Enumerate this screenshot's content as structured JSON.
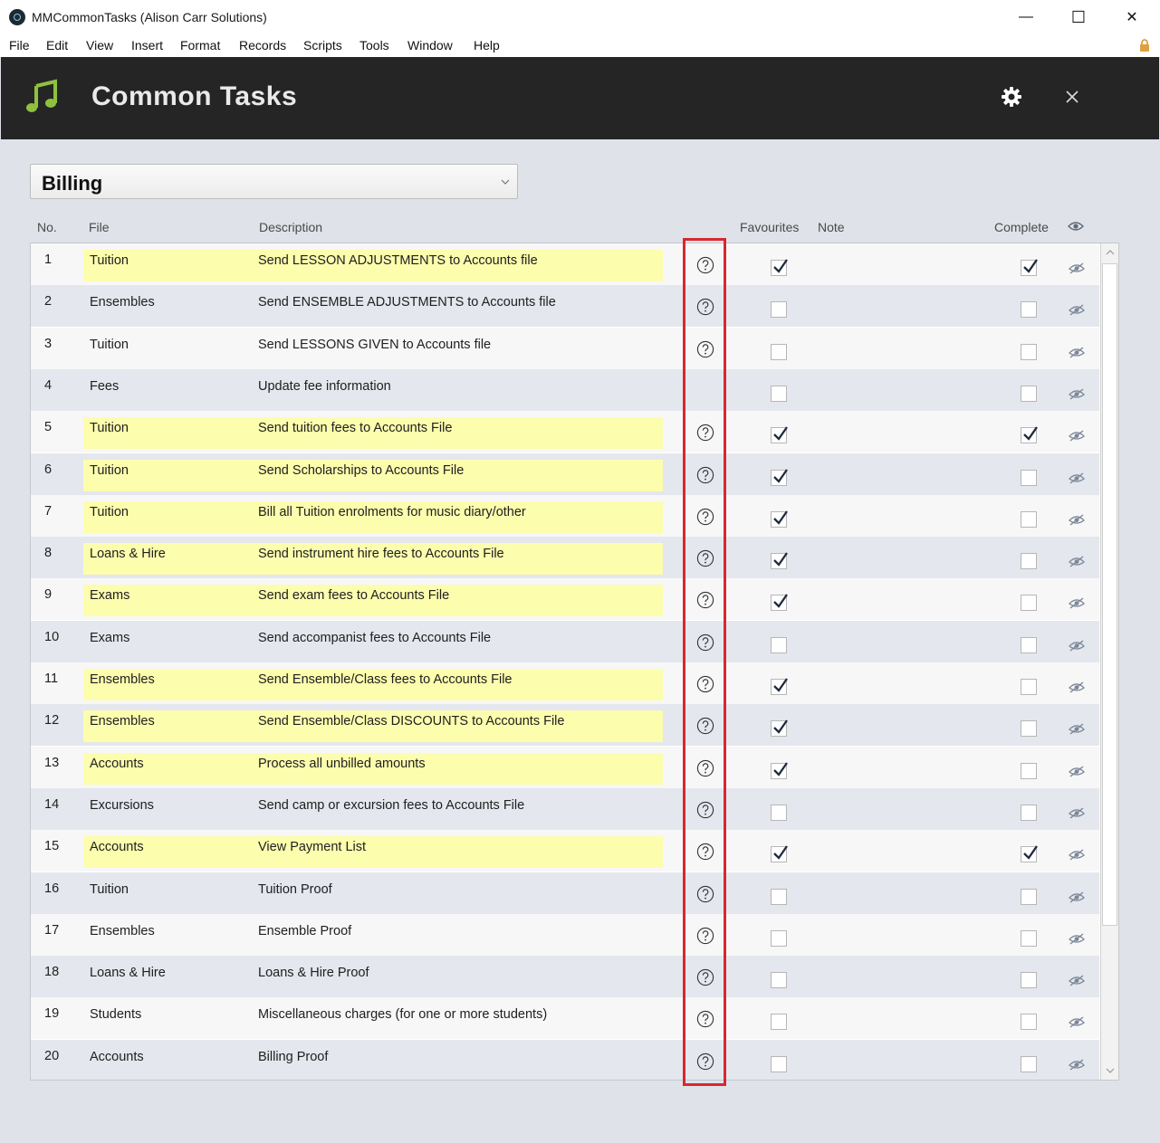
{
  "window": {
    "title": "MMCommonTasks (Alison Carr Solutions)",
    "minimize": "—",
    "maximize": "☐",
    "close": "✕"
  },
  "menu": [
    "File",
    "Edit",
    "View",
    "Insert",
    "Format",
    "Records",
    "Scripts",
    "Tools",
    "Window",
    "Help"
  ],
  "header": {
    "title": "Common Tasks"
  },
  "category": {
    "selected": "Billing"
  },
  "columns": {
    "no": "No.",
    "file": "File",
    "description": "Description",
    "favourites": "Favourites",
    "note": "Note",
    "complete": "Complete"
  },
  "colors": {
    "highlight": "#fdfdae",
    "header_bg": "#252525",
    "accent_green": "#8fc13f",
    "annotation_red": "#d62830"
  },
  "rows": [
    {
      "no": "1",
      "file": "Tuition",
      "description": "Send LESSON ADJUSTMENTS to Accounts file",
      "highlight": true,
      "help": true,
      "favourite": true,
      "complete": true
    },
    {
      "no": "2",
      "file": "Ensembles",
      "description": "Send ENSEMBLE ADJUSTMENTS to Accounts file",
      "highlight": false,
      "help": true,
      "favourite": false,
      "complete": false
    },
    {
      "no": "3",
      "file": "Tuition",
      "description": "Send LESSONS GIVEN to Accounts file",
      "highlight": false,
      "help": true,
      "favourite": false,
      "complete": false
    },
    {
      "no": "4",
      "file": "Fees",
      "description": "Update fee information",
      "highlight": false,
      "help": false,
      "favourite": false,
      "complete": false
    },
    {
      "no": "5",
      "file": "Tuition",
      "description": "Send tuition fees to Accounts File",
      "highlight": true,
      "help": true,
      "favourite": true,
      "complete": true
    },
    {
      "no": "6",
      "file": "Tuition",
      "description": "Send Scholarships to Accounts File",
      "highlight": true,
      "help": true,
      "favourite": true,
      "complete": false
    },
    {
      "no": "7",
      "file": "Tuition",
      "description": "Bill all Tuition enrolments for music diary/other",
      "highlight": true,
      "help": true,
      "favourite": true,
      "complete": false
    },
    {
      "no": "8",
      "file": "Loans & Hire",
      "description": "Send instrument hire fees to Accounts File",
      "highlight": true,
      "help": true,
      "favourite": true,
      "complete": false
    },
    {
      "no": "9",
      "file": "Exams",
      "description": "Send exam fees to Accounts File",
      "highlight": true,
      "help": true,
      "favourite": true,
      "complete": false
    },
    {
      "no": "10",
      "file": "Exams",
      "description": "Send accompanist fees to Accounts File",
      "highlight": false,
      "help": true,
      "favourite": false,
      "complete": false
    },
    {
      "no": "11",
      "file": "Ensembles",
      "description": "Send Ensemble/Class fees to Accounts File",
      "highlight": true,
      "help": true,
      "favourite": true,
      "complete": false
    },
    {
      "no": "12",
      "file": "Ensembles",
      "description": "Send Ensemble/Class DISCOUNTS to Accounts File",
      "highlight": true,
      "help": true,
      "favourite": true,
      "complete": false
    },
    {
      "no": "13",
      "file": "Accounts",
      "description": "Process all unbilled amounts",
      "highlight": true,
      "help": true,
      "favourite": true,
      "complete": false
    },
    {
      "no": "14",
      "file": "Excursions",
      "description": "Send camp or excursion fees to Accounts File",
      "highlight": false,
      "help": true,
      "favourite": false,
      "complete": false
    },
    {
      "no": "15",
      "file": "Accounts",
      "description": "View Payment List",
      "highlight": true,
      "help": true,
      "favourite": true,
      "complete": true
    },
    {
      "no": "16",
      "file": "Tuition",
      "description": "Tuition Proof",
      "highlight": false,
      "help": true,
      "favourite": false,
      "complete": false
    },
    {
      "no": "17",
      "file": "Ensembles",
      "description": "Ensemble Proof",
      "highlight": false,
      "help": true,
      "favourite": false,
      "complete": false
    },
    {
      "no": "18",
      "file": "Loans & Hire",
      "description": "Loans & Hire Proof",
      "highlight": false,
      "help": true,
      "favourite": false,
      "complete": false
    },
    {
      "no": "19",
      "file": "Students",
      "description": "Miscellaneous charges (for one or more students)",
      "highlight": false,
      "help": true,
      "favourite": false,
      "complete": false
    },
    {
      "no": "20",
      "file": "Accounts",
      "description": "Billing Proof",
      "highlight": false,
      "help": true,
      "favourite": false,
      "complete": false
    }
  ]
}
